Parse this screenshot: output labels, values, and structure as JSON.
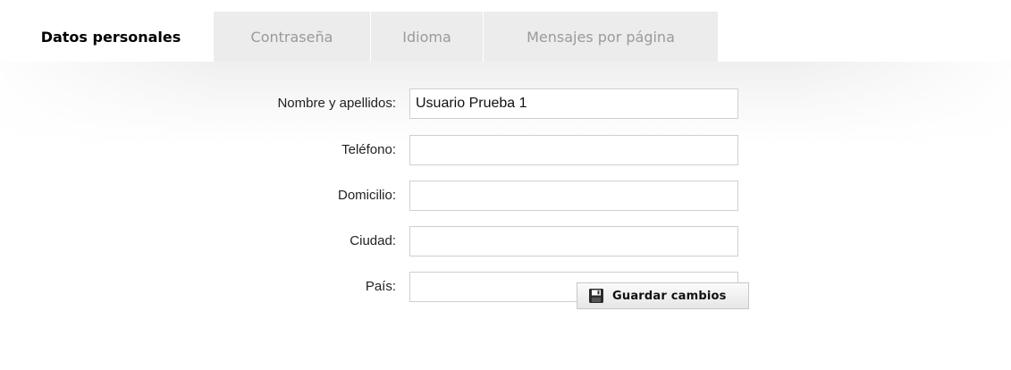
{
  "tabs": [
    {
      "label": "Datos personales",
      "active": true
    },
    {
      "label": "Contraseña",
      "active": false
    },
    {
      "label": "Idioma",
      "active": false
    },
    {
      "label": "Mensajes por página",
      "active": false
    }
  ],
  "form": {
    "fields": [
      {
        "label": "Nombre y apellidos:",
        "value": ""
      },
      {
        "label": "Teléfono:",
        "value": ""
      },
      {
        "label": "Domicilio:",
        "value": ""
      },
      {
        "label": "Ciudad:",
        "value": ""
      },
      {
        "label": "País:",
        "value": ""
      }
    ],
    "name_value": "Usuario Prueba 1"
  },
  "actions": {
    "save_label": "Guardar cambios",
    "save_icon": "floppy-disk-icon"
  },
  "colors": {
    "tab_inactive_bg": "#ececec",
    "tab_inactive_text": "#9a9a9a",
    "tab_active_text": "#000000",
    "input_border": "#cfcfcf"
  }
}
